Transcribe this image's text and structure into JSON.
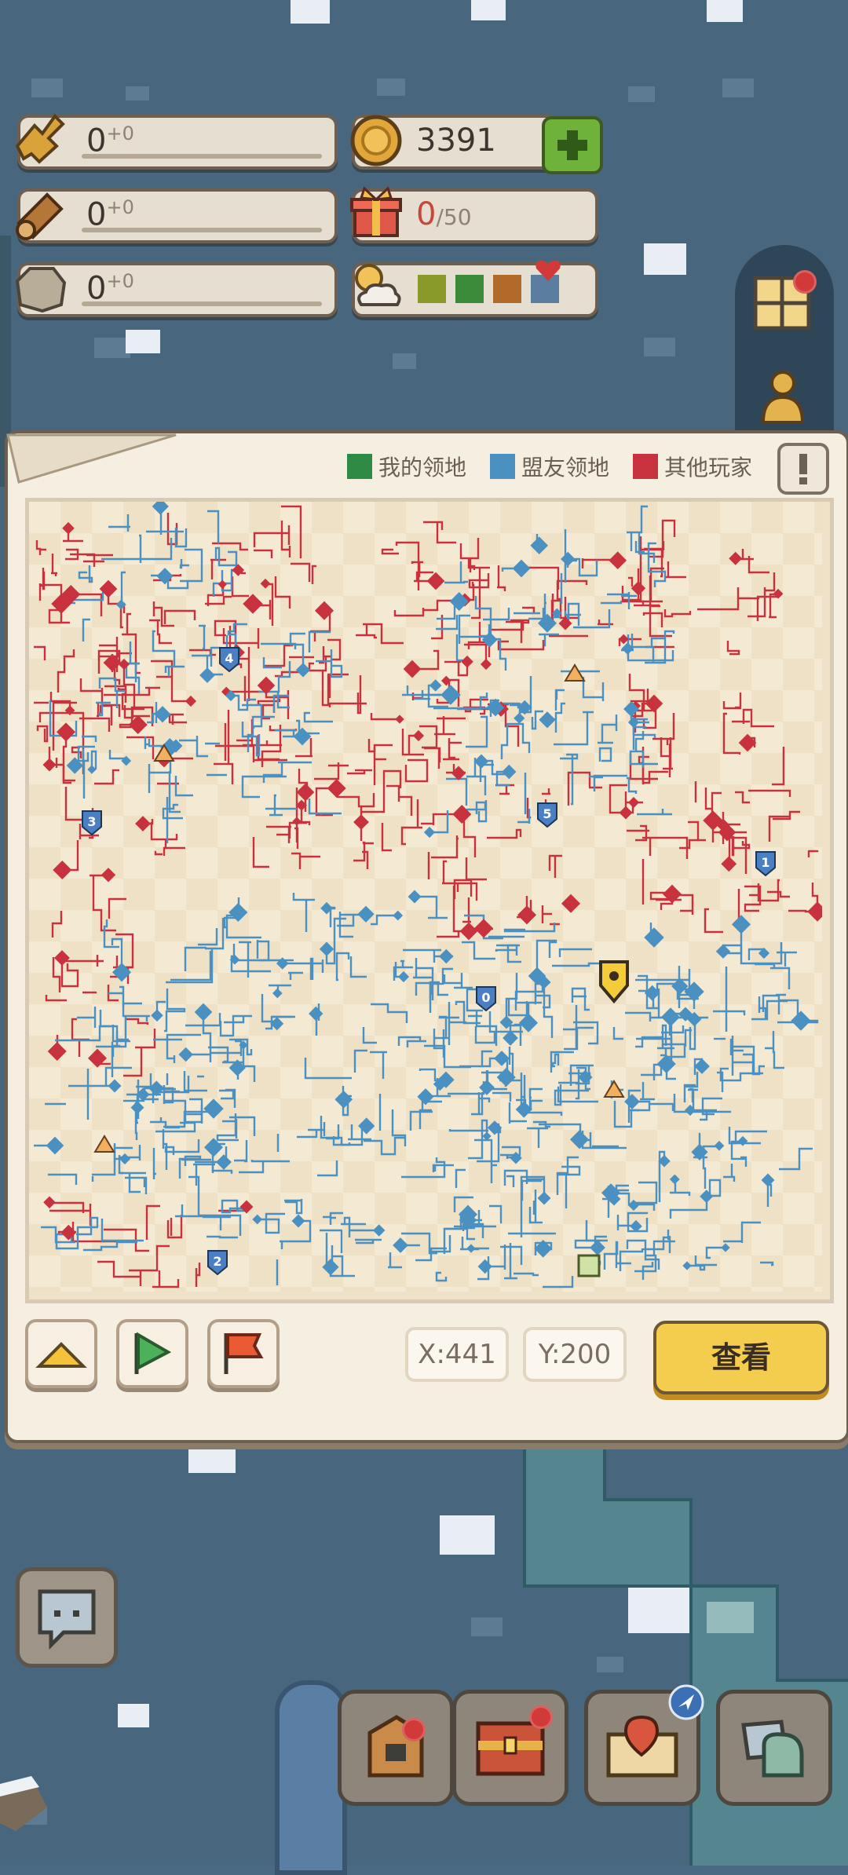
{
  "resources": {
    "food": {
      "icon": "wheat-icon",
      "value": "0",
      "delta": "+0"
    },
    "wood": {
      "icon": "log-icon",
      "value": "0",
      "delta": "+0"
    },
    "stone": {
      "icon": "stone-icon",
      "value": "0",
      "delta": "+0"
    },
    "coins": {
      "icon": "coin-icon",
      "value": "3391"
    },
    "gifts": {
      "icon": "gift-icon",
      "current": "0",
      "max": "/50"
    },
    "season": {
      "icon": "weather-icon",
      "bars": [
        "#8a9a2a",
        "#3a8a3a",
        "#b06a2a",
        "#5b7ea0"
      ]
    }
  },
  "legend": [
    {
      "label": "我的领地",
      "color": "#2e8b45"
    },
    {
      "label": "盟友领地",
      "color": "#4a90c0"
    },
    {
      "label": "其他玩家",
      "color": "#c8323f"
    }
  ],
  "map": {
    "markers": [
      {
        "label": "4",
        "color": "#4a7fc4"
      },
      {
        "label": "3",
        "color": "#4a7fc4"
      },
      {
        "label": "5",
        "color": "#4a7fc4"
      },
      {
        "label": "1",
        "color": "#4a7fc4"
      },
      {
        "label": "0",
        "color": "#4a7fc4"
      },
      {
        "label": "2",
        "color": "#4a7fc4"
      }
    ]
  },
  "toolbar": {
    "coord_x": "X:441",
    "coord_y": "Y:200",
    "view_label": "查看",
    "buttons": [
      "home-tent-icon",
      "green-flag-icon",
      "red-flag-icon"
    ]
  },
  "bottom_bar": [
    "chat-icon",
    "bag-icon",
    "chest-icon",
    "map-scroll-icon",
    "pet-icon"
  ]
}
